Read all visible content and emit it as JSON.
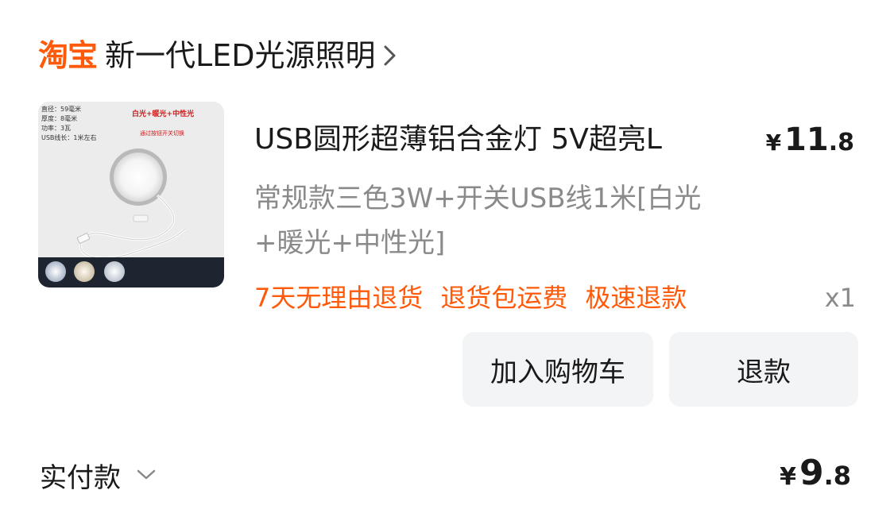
{
  "shop": {
    "logo": "淘宝",
    "name": "新一代LED光源照明"
  },
  "product": {
    "title": "USB圆形超薄铝合金灯 5V超亮L",
    "price_symbol": "¥",
    "price_int": "11",
    "price_dec": ".8",
    "variant": "常规款三色3W+开关USB线1米[白光+暖光+中性光]",
    "quantity": "x1",
    "image": {
      "specs": [
        "直径：59毫米",
        "厚度：8毫米",
        "功率：3瓦",
        "USB线长：1米左右"
      ],
      "colors_title": "白光+暖光+中性光",
      "switch_note": "通过按钮开关切换"
    }
  },
  "service_tags": [
    "7天无理由退货",
    "退货包运费",
    "极速退款"
  ],
  "actions": {
    "add_to_cart": "加入购物车",
    "refund": "退款"
  },
  "payment": {
    "label": "实付款",
    "price_symbol": "¥",
    "price_int": "9",
    "price_dec": ".8"
  },
  "colors": {
    "brand": "#ff5a0a",
    "secondary_text": "#8a8a8a",
    "button_bg": "#f3f4f6"
  },
  "icons": {
    "shop_chevron": "chevron-right-icon",
    "paid_chevron": "chevron-down-icon"
  }
}
